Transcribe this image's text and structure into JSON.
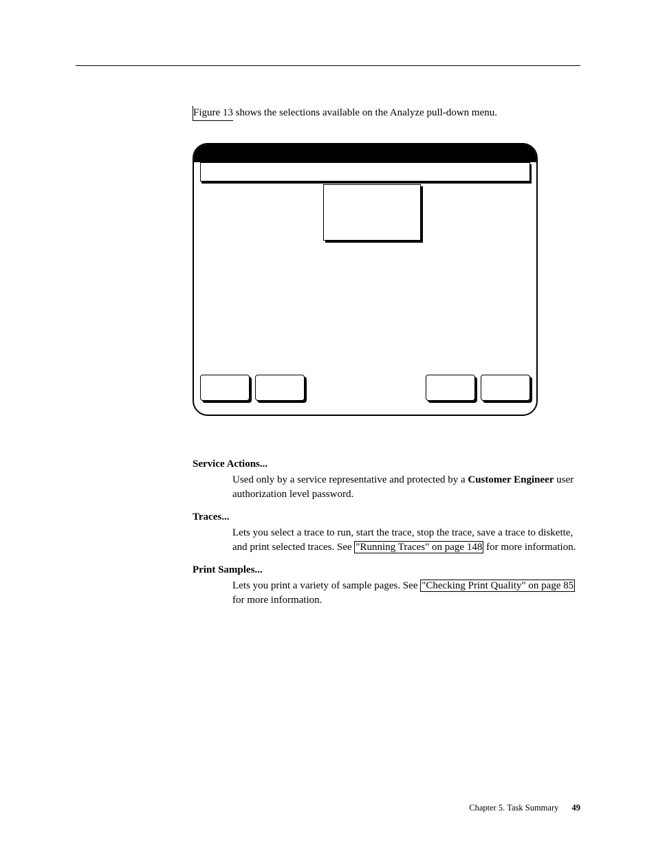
{
  "intro": {
    "figure_ref": "Figure 13",
    "text_after": " shows the selections available on the Analyze pull-down menu."
  },
  "definitions": [
    {
      "term": "Service Actions...",
      "desc_parts": [
        {
          "text": "Used only by a service representative and protected by a "
        },
        {
          "text": "Customer Engineer",
          "bold": true
        },
        {
          "text": " user authorization level password."
        }
      ]
    },
    {
      "term": "Traces...",
      "desc_parts": [
        {
          "text": "Lets you select a trace to run, start the trace, stop the trace, save a trace to diskette, and print selected traces. See "
        },
        {
          "text": "\"Running Traces\" on page 148",
          "link": true
        },
        {
          "text": " for more information."
        }
      ]
    },
    {
      "term": "Print Samples...",
      "desc_parts": [
        {
          "text": "Lets you print a variety of sample pages. See "
        },
        {
          "text": "\"Checking Print Quality\" on page 85",
          "link": true
        },
        {
          "text": " for more information."
        }
      ]
    }
  ],
  "footer": {
    "chapter": "Chapter 5. Task Summary",
    "page": "49"
  }
}
